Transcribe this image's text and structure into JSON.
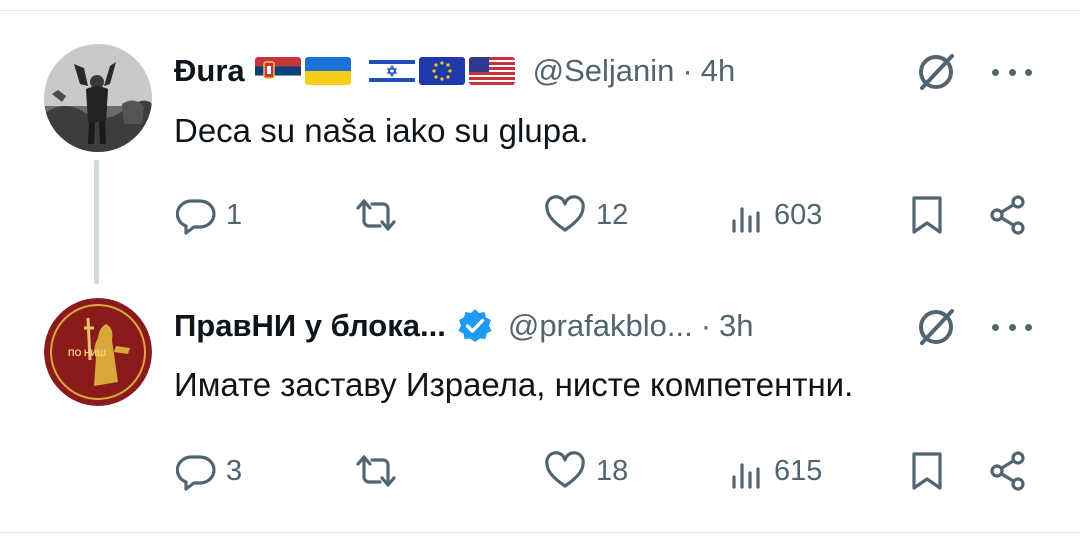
{
  "tweets": [
    {
      "author_name": "Đura",
      "flags": [
        "flag-serbia",
        "flag-ukraine",
        "flag-israel",
        "flag-eu",
        "flag-usa"
      ],
      "handle": "@Seljanin",
      "separator": "·",
      "time": "4h",
      "text": "Deca su naša iako su glupa.",
      "replies": "1",
      "reposts": "",
      "likes": "12",
      "views": "603"
    },
    {
      "author_name": "ПравНИ у блока...",
      "verified": true,
      "handle": "@prafakblo...",
      "separator": "·",
      "time": "3h",
      "text": "Имате заставу Израела, нисте компетентни.",
      "replies": "3",
      "reposts": "",
      "likes": "18",
      "views": "615",
      "avatar_label": "ПО НИШ"
    }
  ],
  "colors": {
    "text_primary": "#0f1419",
    "text_secondary": "#536471",
    "verified_blue": "#1d9bf0",
    "avatar2_red": "#8b1a1a",
    "avatar2_gold": "#d9a83a"
  }
}
